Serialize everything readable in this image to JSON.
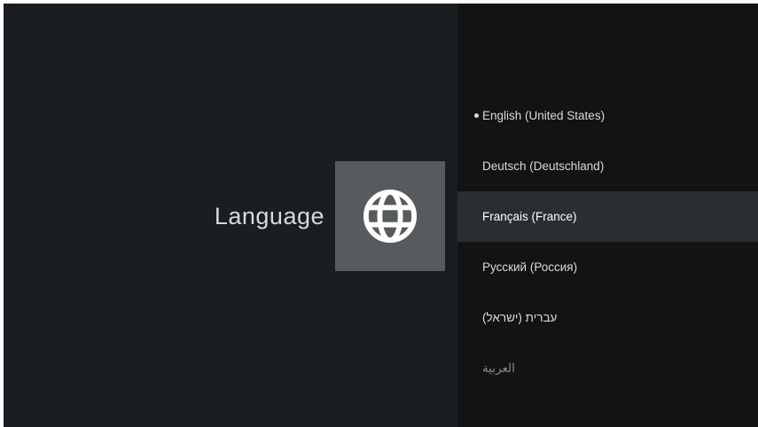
{
  "page": {
    "title": "Language",
    "icon": "globe-icon"
  },
  "languages": [
    {
      "label": "English (United States)",
      "selected": true,
      "focused": false
    },
    {
      "label": "Deutsch (Deutschland)",
      "selected": false,
      "focused": false
    },
    {
      "label": "Français (France)",
      "selected": false,
      "focused": true
    },
    {
      "label": "Русский (Россия)",
      "selected": false,
      "focused": false
    },
    {
      "label": "עברית (ישראל)",
      "selected": false,
      "focused": false
    },
    {
      "label": "العربية",
      "selected": false,
      "focused": false
    }
  ],
  "colors": {
    "background": "#1b1e20",
    "list_background": "#111314",
    "focused_row": "#2b2e30",
    "icon_tile": "#575b5d"
  }
}
